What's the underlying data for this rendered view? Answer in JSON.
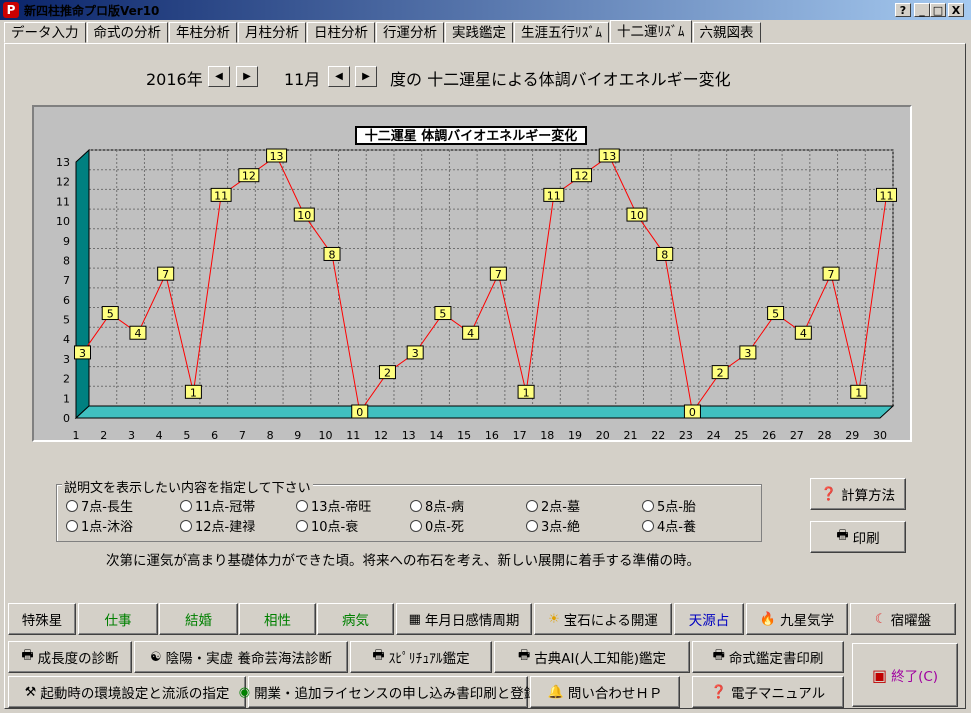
{
  "window": {
    "title": "新四柱推命プロ版Ver10",
    "app_icon": "P",
    "controls": [
      "?",
      "_",
      "□",
      "X"
    ]
  },
  "tabs": [
    {
      "label": "データ入力",
      "active": false
    },
    {
      "label": "命式の分析",
      "active": false
    },
    {
      "label": "年柱分析",
      "active": false
    },
    {
      "label": "月柱分析",
      "active": false
    },
    {
      "label": "日柱分析",
      "active": false
    },
    {
      "label": "行運分析",
      "active": false
    },
    {
      "label": "実践鑑定",
      "active": false
    },
    {
      "label": "生涯五行ﾘｽﾞﾑ",
      "active": false
    },
    {
      "label": "十二運ﾘｽﾞﾑ",
      "active": true
    },
    {
      "label": "六親図表",
      "active": false
    }
  ],
  "header": {
    "year": "2016年",
    "month": "11月",
    "title": "度の 十二運星による体調バイオエネルギー変化",
    "prev_icon": "◀",
    "next_icon": "▶"
  },
  "chart_data": {
    "type": "line",
    "title": "十二運星 体調バイオエネルギー変化",
    "x": [
      1,
      2,
      3,
      4,
      5,
      6,
      7,
      8,
      9,
      10,
      11,
      12,
      13,
      14,
      15,
      16,
      17,
      18,
      19,
      20,
      21,
      22,
      23,
      24,
      25,
      26,
      27,
      28,
      29,
      30
    ],
    "series": [
      {
        "values": [
          3,
          5,
          4,
          7,
          1,
          11,
          12,
          13,
          10,
          8,
          0,
          2,
          3,
          5,
          4,
          7,
          1,
          11,
          12,
          13,
          10,
          8,
          0,
          2,
          3,
          5,
          4,
          7,
          1,
          11
        ],
        "color": "#ff0000"
      }
    ],
    "ylim": [
      0,
      13
    ],
    "yticks": [
      0,
      1,
      2,
      3,
      4,
      5,
      6,
      7,
      8,
      9,
      10,
      11,
      12,
      13
    ],
    "grid": true,
    "wall_color": "#008080",
    "floor_color": "#40c0c0",
    "label_bg": "#ffff80"
  },
  "options": {
    "legend": "説明文を表示したい内容を指定して下さい",
    "row1": [
      "7点-長生",
      "11点-冠帯",
      "13点-帝旺",
      "8点-病",
      "2点-墓",
      "5点-胎"
    ],
    "row2": [
      "1点-沐浴",
      "12点-建禄",
      "10点-衰",
      "0点-死",
      "3点-絶",
      "4点-養"
    ]
  },
  "description": "次第に運気が高まり基礎体力ができた頃。将来への布石を考え、新しい展開に着手する準備の時。",
  "side_buttons": {
    "calc": "計算方法",
    "print": "印刷"
  },
  "bottom": {
    "row1": [
      "特殊星",
      "仕事",
      "結婚",
      "相性",
      "病気",
      "年月日感情周期",
      "宝石による開運",
      "天源占",
      "九星気学",
      "宿曜盤"
    ],
    "row2": [
      "成長度の診断",
      "陰陽・実虚 養命芸海法診断",
      "ｽﾋﾟﾘﾁｭｱﾙ鑑定",
      "古典AI(人工知能)鑑定",
      "命式鑑定書印刷"
    ],
    "row3": [
      "起動時の環境設定と流派の指定",
      "開業・追加ライセンスの申し込み書印刷と登録",
      "問い合わせＨＰ",
      "電子マニュアル"
    ],
    "exit": "終了(C)"
  }
}
